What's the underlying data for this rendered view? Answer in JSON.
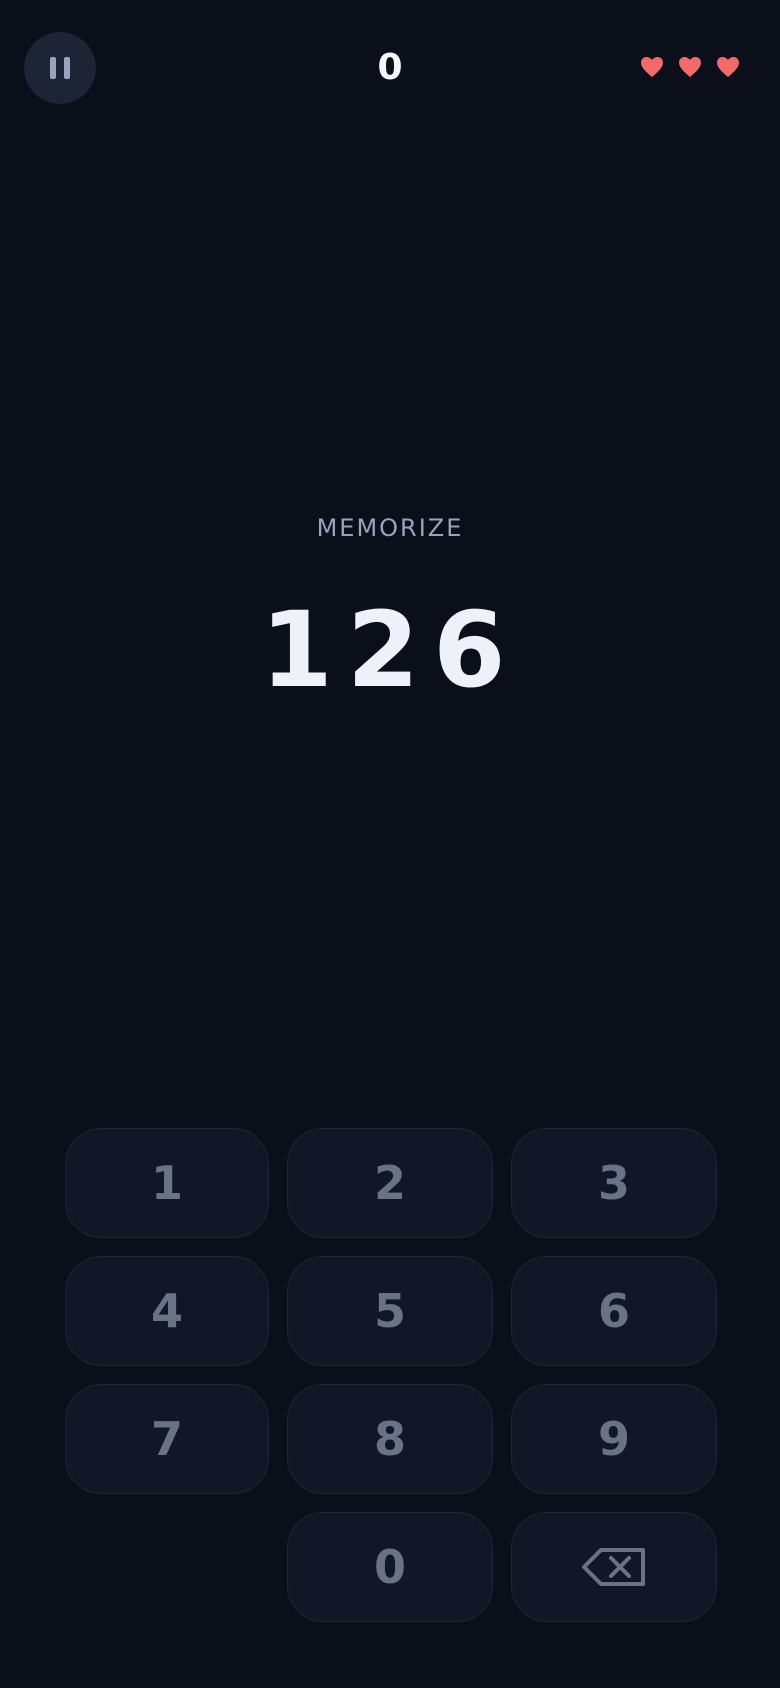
{
  "hud": {
    "pause_icon": "pause-icon",
    "score": "0",
    "lives": 3,
    "life_icon": "heart-icon",
    "life_color": "#f26b6b"
  },
  "game": {
    "prompt": "MEMORIZE",
    "sequence": "126"
  },
  "keypad": {
    "keys": [
      "1",
      "2",
      "3",
      "4",
      "5",
      "6",
      "7",
      "8",
      "9",
      "0"
    ],
    "backspace_icon": "backspace-icon",
    "backspace_glyph": "⌫"
  },
  "colors": {
    "background": "#0b0f1a",
    "pause_button": "#1c2436",
    "key_background": "#121727",
    "key_text": "#6b7286",
    "prompt_text": "#9aa3bd",
    "sequence_text": "#eef1f8"
  }
}
